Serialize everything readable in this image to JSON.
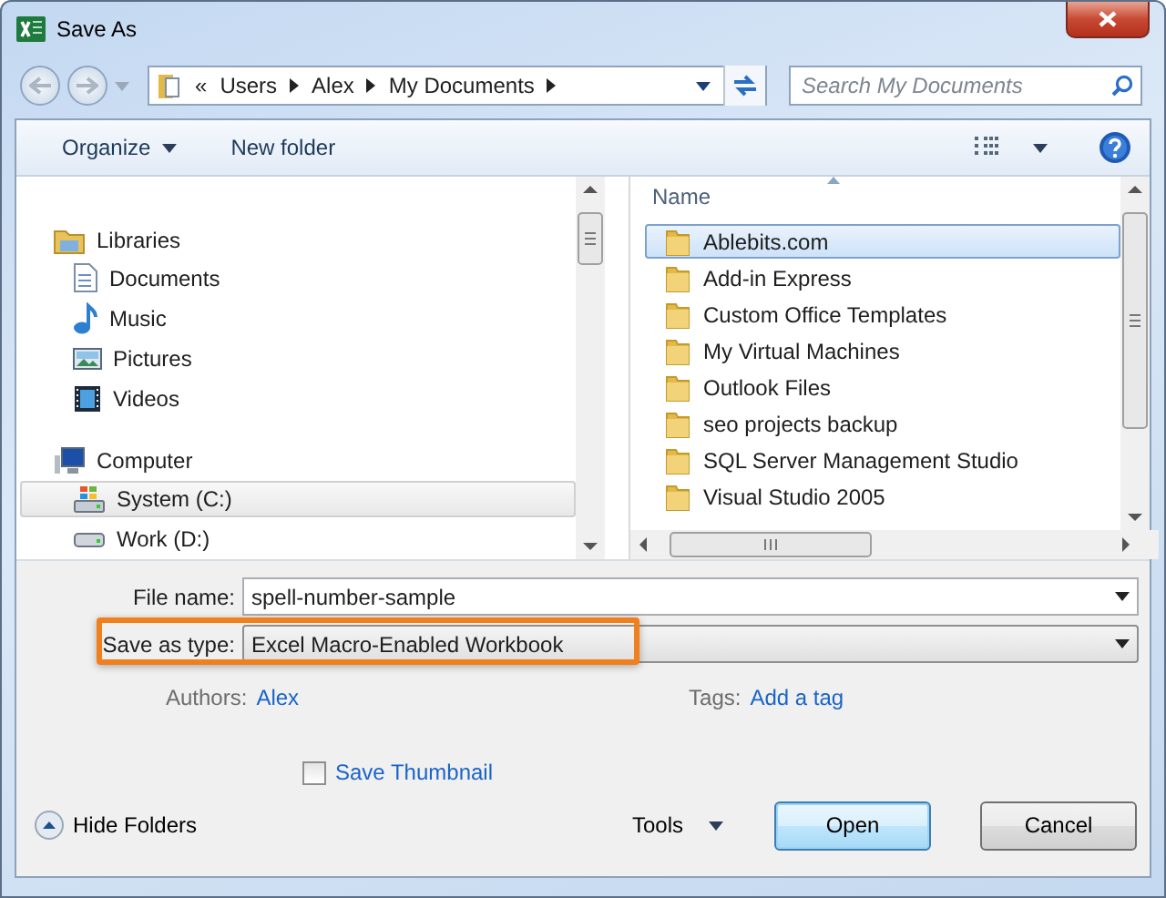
{
  "window": {
    "title": "Save As"
  },
  "address": {
    "overflow": "«",
    "crumbs": [
      "Users",
      "Alex",
      "My Documents"
    ]
  },
  "search": {
    "placeholder": "Search My Documents"
  },
  "toolbar": {
    "organize": "Organize",
    "new_folder": "New folder"
  },
  "nav_pane": {
    "groups": [
      {
        "label": "Libraries",
        "kind": "libraries",
        "children": [
          {
            "label": "Documents",
            "kind": "documents",
            "selected": false
          },
          {
            "label": "Music",
            "kind": "music",
            "selected": false
          },
          {
            "label": "Pictures",
            "kind": "pictures",
            "selected": false
          },
          {
            "label": "Videos",
            "kind": "videos",
            "selected": false
          }
        ]
      },
      {
        "label": "Computer",
        "kind": "computer",
        "children": [
          {
            "label": "System (C:)",
            "kind": "system",
            "selected": true
          },
          {
            "label": "Work (D:)",
            "kind": "drive",
            "selected": false
          }
        ]
      }
    ]
  },
  "file_list": {
    "columns": [
      "Name"
    ],
    "rows": [
      {
        "name": "Ablebits.com",
        "selected": true
      },
      {
        "name": "Add-in Express",
        "selected": false
      },
      {
        "name": "Custom Office Templates",
        "selected": false
      },
      {
        "name": "My Virtual Machines",
        "selected": false
      },
      {
        "name": "Outlook Files",
        "selected": false
      },
      {
        "name": "seo projects backup",
        "selected": false
      },
      {
        "name": "SQL Server Management Studio",
        "selected": false
      },
      {
        "name": "Visual Studio 2005",
        "selected": false
      }
    ]
  },
  "form": {
    "file_name_label": "File name:",
    "file_name": "spell-number-sample",
    "type_label": "Save as type:",
    "type": "Excel Macro-Enabled Workbook",
    "type_highlighted": true,
    "authors_label": "Authors:",
    "authors": "Alex",
    "tags_label": "Tags:",
    "tags": "Add a tag",
    "thumbnail": {
      "label": "Save Thumbnail",
      "checked": false
    }
  },
  "footer": {
    "hide_folders": "Hide Folders",
    "tools": "Tools",
    "buttons": [
      {
        "label": "Open",
        "default": true
      },
      {
        "label": "Cancel",
        "default": false
      }
    ]
  }
}
